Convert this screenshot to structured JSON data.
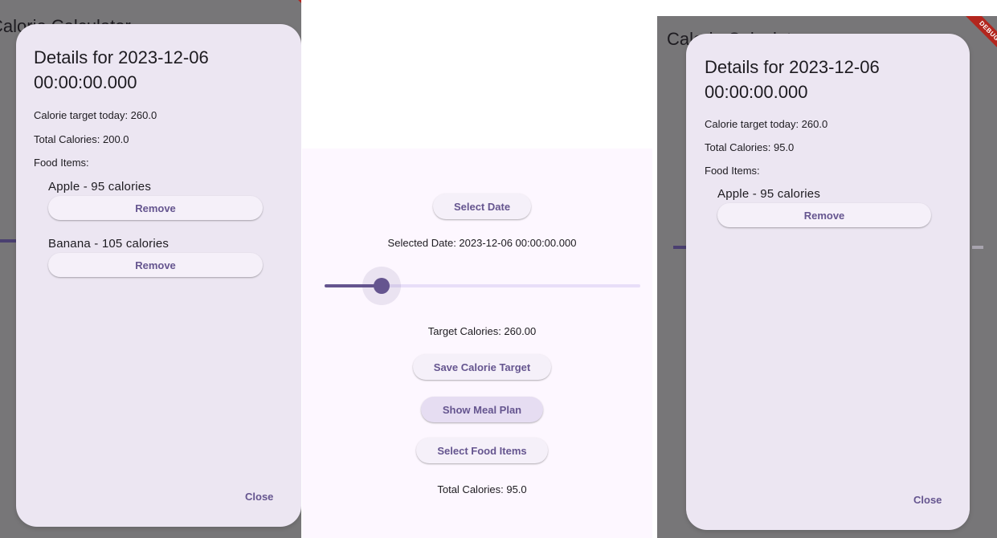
{
  "left_panel": {
    "behind_title": "Calorie Calculator",
    "dialog": {
      "title": "Details for 2023-12-06\n00:00:00.000",
      "calorie_target": "Calorie target today: 260.0",
      "total_calories": "Total Calories: 200.0",
      "food_items_label": "Food Items:",
      "items": [
        {
          "name": "Apple - 95 calories",
          "remove_label": "Remove"
        },
        {
          "name": "Banana - 105 calories",
          "remove_label": "Remove"
        }
      ],
      "close_label": "Close"
    }
  },
  "middle_panel": {
    "select_date_label": "Select Date",
    "selected_date_text": "Selected Date: 2023-12-06 00:00:00.000",
    "slider_value_fraction": 0.18,
    "target_calories_text": "Target Calories: 260.00",
    "save_target_label": "Save Calorie Target",
    "show_meal_plan_label": "Show Meal Plan",
    "select_food_items_label": "Select Food Items",
    "total_calories_text": "Total Calories: 95.0"
  },
  "right_panel": {
    "behind_title": "Calorie Calculator",
    "debug_banner": "DEBUG",
    "dialog": {
      "title": "Details for 2023-12-06\n00:00:00.000",
      "calorie_target": "Calorie target today: 260.0",
      "total_calories": "Total Calories: 95.0",
      "food_items_label": "Food Items:",
      "items": [
        {
          "name": "Apple - 95 calories",
          "remove_label": "Remove"
        }
      ],
      "close_label": "Close"
    }
  },
  "colors": {
    "scrim": "#777678",
    "dialog_bg": "#ece6f2",
    "accent": "#65558f",
    "page_bg": "#fdf7ff",
    "debug_red": "#b3261e"
  }
}
